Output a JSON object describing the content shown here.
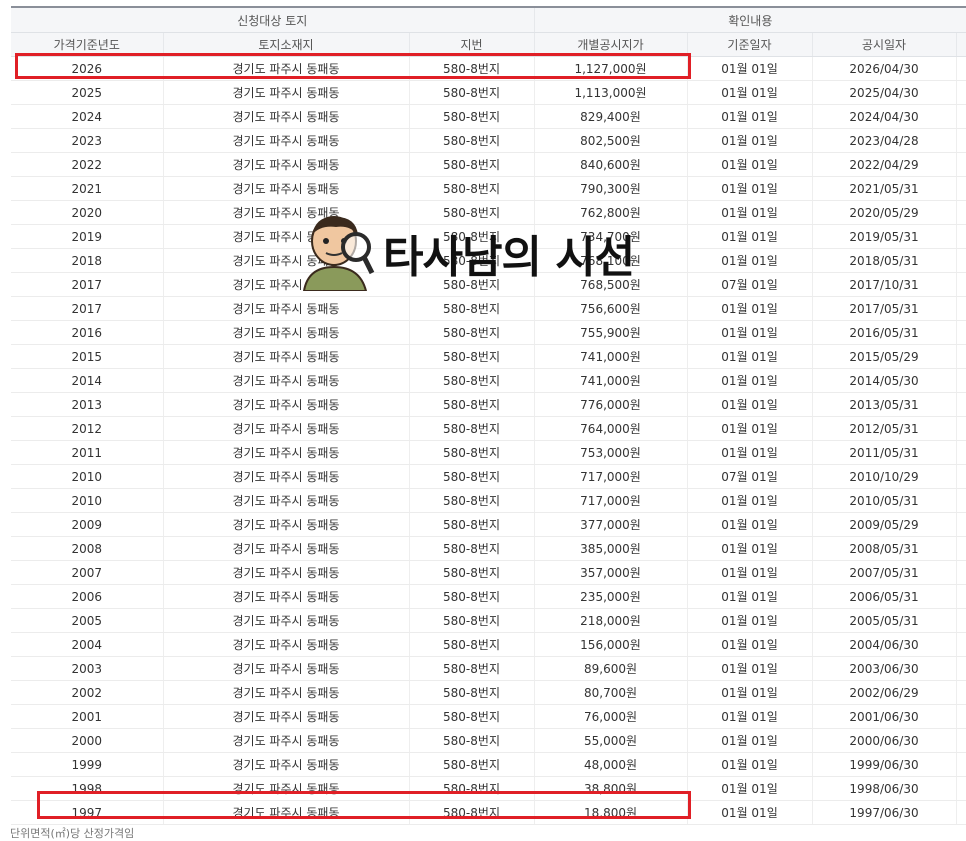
{
  "header": {
    "group_left": "신청대상 토지",
    "group_right": "확인내용",
    "cols": [
      "가격기준년도",
      "토지소재지",
      "지번",
      "개별공시지가",
      "기준일자",
      "공시일자"
    ]
  },
  "rows": [
    [
      "2026",
      "경기도 파주시 동패동",
      "580-8번지",
      "1,127,000원",
      "01월 01일",
      "2026/04/30"
    ],
    [
      "2025",
      "경기도 파주시 동패동",
      "580-8번지",
      "1,113,000원",
      "01월 01일",
      "2025/04/30"
    ],
    [
      "2024",
      "경기도 파주시 동패동",
      "580-8번지",
      "829,400원",
      "01월 01일",
      "2024/04/30"
    ],
    [
      "2023",
      "경기도 파주시 동패동",
      "580-8번지",
      "802,500원",
      "01월 01일",
      "2023/04/28"
    ],
    [
      "2022",
      "경기도 파주시 동패동",
      "580-8번지",
      "840,600원",
      "01월 01일",
      "2022/04/29"
    ],
    [
      "2021",
      "경기도 파주시 동패동",
      "580-8번지",
      "790,300원",
      "01월 01일",
      "2021/05/31"
    ],
    [
      "2020",
      "경기도 파주시 동패동",
      "580-8번지",
      "762,800원",
      "01월 01일",
      "2020/05/29"
    ],
    [
      "2019",
      "경기도 파주시 동패동",
      "580-8번지",
      "734,700원",
      "01월 01일",
      "2019/05/31"
    ],
    [
      "2018",
      "경기도 파주시 동패동",
      "580-8번지",
      "768,100원",
      "01월 01일",
      "2018/05/31"
    ],
    [
      "2017",
      "경기도 파주시 동패동",
      "580-8번지",
      "768,500원",
      "07월 01일",
      "2017/10/31"
    ],
    [
      "2017",
      "경기도 파주시 동패동",
      "580-8번지",
      "756,600원",
      "01월 01일",
      "2017/05/31"
    ],
    [
      "2016",
      "경기도 파주시 동패동",
      "580-8번지",
      "755,900원",
      "01월 01일",
      "2016/05/31"
    ],
    [
      "2015",
      "경기도 파주시 동패동",
      "580-8번지",
      "741,000원",
      "01월 01일",
      "2015/05/29"
    ],
    [
      "2014",
      "경기도 파주시 동패동",
      "580-8번지",
      "741,000원",
      "01월 01일",
      "2014/05/30"
    ],
    [
      "2013",
      "경기도 파주시 동패동",
      "580-8번지",
      "776,000원",
      "01월 01일",
      "2013/05/31"
    ],
    [
      "2012",
      "경기도 파주시 동패동",
      "580-8번지",
      "764,000원",
      "01월 01일",
      "2012/05/31"
    ],
    [
      "2011",
      "경기도 파주시 동패동",
      "580-8번지",
      "753,000원",
      "01월 01일",
      "2011/05/31"
    ],
    [
      "2010",
      "경기도 파주시 동패동",
      "580-8번지",
      "717,000원",
      "07월 01일",
      "2010/10/29"
    ],
    [
      "2010",
      "경기도 파주시 동패동",
      "580-8번지",
      "717,000원",
      "01월 01일",
      "2010/05/31"
    ],
    [
      "2009",
      "경기도 파주시 동패동",
      "580-8번지",
      "377,000원",
      "01월 01일",
      "2009/05/29"
    ],
    [
      "2008",
      "경기도 파주시 동패동",
      "580-8번지",
      "385,000원",
      "01월 01일",
      "2008/05/31"
    ],
    [
      "2007",
      "경기도 파주시 동패동",
      "580-8번지",
      "357,000원",
      "01월 01일",
      "2007/05/31"
    ],
    [
      "2006",
      "경기도 파주시 동패동",
      "580-8번지",
      "235,000원",
      "01월 01일",
      "2006/05/31"
    ],
    [
      "2005",
      "경기도 파주시 동패동",
      "580-8번지",
      "218,000원",
      "01월 01일",
      "2005/05/31"
    ],
    [
      "2004",
      "경기도 파주시 동패동",
      "580-8번지",
      "156,000원",
      "01월 01일",
      "2004/06/30"
    ],
    [
      "2003",
      "경기도 파주시 동패동",
      "580-8번지",
      "89,600원",
      "01월 01일",
      "2003/06/30"
    ],
    [
      "2002",
      "경기도 파주시 동패동",
      "580-8번지",
      "80,700원",
      "01월 01일",
      "2002/06/29"
    ],
    [
      "2001",
      "경기도 파주시 동패동",
      "580-8번지",
      "76,000원",
      "01월 01일",
      "2001/06/30"
    ],
    [
      "2000",
      "경기도 파주시 동패동",
      "580-8번지",
      "55,000원",
      "01월 01일",
      "2000/06/30"
    ],
    [
      "1999",
      "경기도 파주시 동패동",
      "580-8번지",
      "48,000원",
      "01월 01일",
      "1999/06/30"
    ],
    [
      "1998",
      "경기도 파주시 동패동",
      "580-8번지",
      "38,800원",
      "01월 01일",
      "1998/06/30"
    ],
    [
      "1997",
      "경기도 파주시 동패동",
      "580-8번지",
      "18,800원",
      "01월 01일",
      "1997/06/30"
    ]
  ],
  "watermark": {
    "text": "타사남의 시선"
  },
  "footer": {
    "note": "단위면적(㎡)당 산정가격임"
  },
  "colors": {
    "highlight": "#e01f26",
    "header_bg": "#f5f6f8"
  }
}
